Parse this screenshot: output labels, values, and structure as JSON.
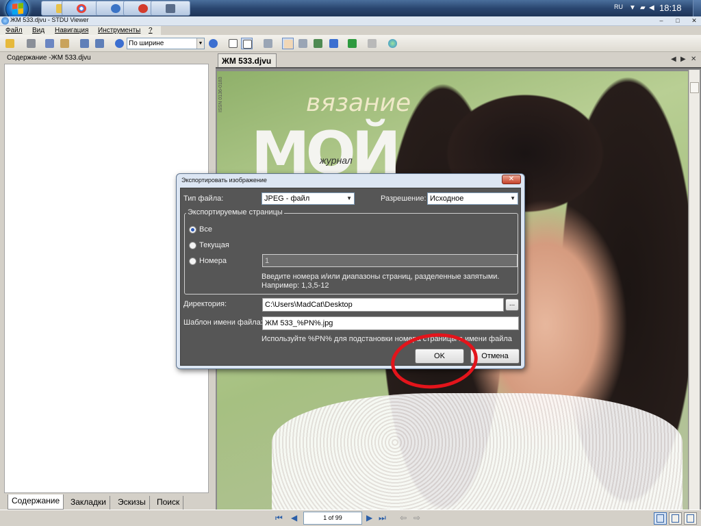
{
  "window": {
    "title": "ЖМ 533.djvu - STDU Viewer"
  },
  "taskbar": {
    "lang": "RU",
    "clock": "18:18",
    "tray_arrow": "▼",
    "buttons": [
      {
        "icon": "folder-icon",
        "color": "#e8c24a"
      },
      {
        "icon": "chrome-icon",
        "color": "#4caf50"
      },
      {
        "icon": "app-icon",
        "color": "#3b74c6"
      },
      {
        "icon": "app-icon",
        "color": "#d33b2c"
      },
      {
        "icon": "app-icon",
        "color": "#5a6d8a"
      }
    ]
  },
  "window_controls": {
    "minimize": "–",
    "maximize": "□",
    "close": "✕"
  },
  "menu": {
    "file": "Файл",
    "view": "Вид",
    "navigation": "Навигация",
    "tools": "Инструменты",
    "help": "?"
  },
  "toolbar": {
    "zoom_value": "По ширине"
  },
  "left_panel": {
    "header": "Содержание -ЖМ 533.djvu",
    "tabs": [
      "Содержание",
      "Закладки",
      "Эскизы",
      "Поиск"
    ]
  },
  "document": {
    "tab_label": "ЖМ 533.djvu",
    "cover": {
      "title_top": "вязание",
      "title_main": "МОЙ",
      "title_sub": "журнал",
      "issn": "ISSN 0136-0183"
    }
  },
  "statusbar": {
    "page_indicator": "1 of 99"
  },
  "dialog": {
    "title": "Экспортировать изображение",
    "close_label": "✕",
    "file_type_label": "Тип файла:",
    "file_type_value": "JPEG - файл",
    "resolution_label": "Разрешение:",
    "resolution_value": "Исходное",
    "pages_group_label": "Экспортируемые страницы",
    "radio_all": "Все",
    "radio_current": "Текущая",
    "radio_numbers": "Номера",
    "numbers_value": "1",
    "hint_line1": "Введите номера и/или диапазоны страниц, разделенные запятыми.",
    "hint_line2": "Например: 1,3,5-12",
    "directory_label": "Директория:",
    "directory_value": "C:\\Users\\MadCat\\Desktop",
    "browse_label": "...",
    "template_label": "Шаблон имени файла:",
    "template_value": "ЖМ 533_%PN%.jpg",
    "template_hint": "Используйте %PN% для подстановки номера страницы в имени файла",
    "ok_label": "OK",
    "cancel_label": "Отмена"
  },
  "annotation": {
    "ring_color": "#e3141b"
  }
}
